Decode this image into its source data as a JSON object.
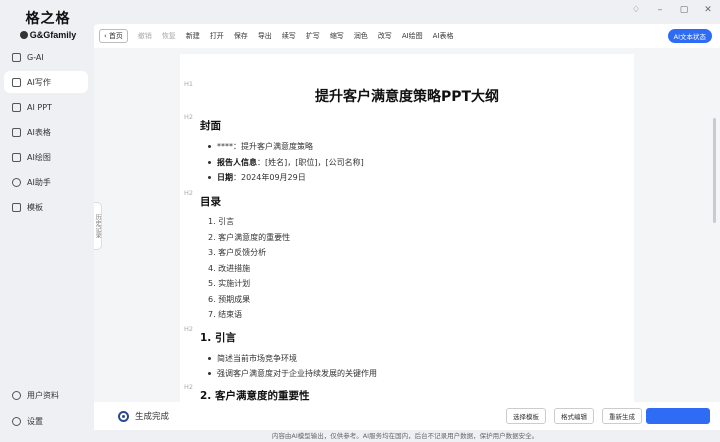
{
  "app": {
    "logo_cn": "格之格",
    "logo_en": "G&Gfamily"
  },
  "sidebar": {
    "items": [
      {
        "label": "G-AI"
      },
      {
        "label": "AI写作"
      },
      {
        "label": "AI PPT"
      },
      {
        "label": "AI表格"
      },
      {
        "label": "AI绘图"
      },
      {
        "label": "AI助手"
      },
      {
        "label": "模板"
      }
    ],
    "bottom": [
      {
        "label": "用户资料"
      },
      {
        "label": "设置"
      }
    ]
  },
  "toolbar": {
    "back": "首页",
    "items": [
      "撤销",
      "恢复",
      "新建",
      "打开",
      "保存",
      "导出",
      "续写",
      "扩写",
      "缩写",
      "润色",
      "改写",
      "AI绘图",
      "AI表格"
    ],
    "status": "AI文本状态"
  },
  "side_tab": "历史记录",
  "document": {
    "title": "提升客户满意度策略PPT大纲",
    "h1_mark": "H1",
    "h2_mark": "H2",
    "cover": {
      "heading": "封面",
      "items": [
        {
          "label": "****",
          "value": "：提升客户满意度策略"
        },
        {
          "label": "报告人信息",
          "value": "：[姓名]，[职位]，[公司名称]"
        },
        {
          "label": "日期",
          "value": "：2024年09月29日"
        }
      ]
    },
    "toc": {
      "heading": "目录",
      "items": [
        "1. 引言",
        "2. 客户满意度的重要性",
        "3. 客户反馈分析",
        "4. 改进措施",
        "5. 实施计划",
        "6. 预期成果",
        "7. 结束语"
      ]
    },
    "intro": {
      "heading": "1. 引言",
      "items": [
        "简述当前市场竞争环境",
        "强调客户满意度对于企业持续发展的关键作用"
      ]
    },
    "section2": {
      "heading": "2. 客户满意度的重要性"
    }
  },
  "actions": {
    "status": "生成完成",
    "template_btn": "选择模板",
    "format_btn": "格式编辑",
    "regen_btn": "重新生成"
  },
  "footer": "内容由AI模型输出，仅供参考。AI服务均在国内，后台不记录用户数据，保护用户数据安全。"
}
